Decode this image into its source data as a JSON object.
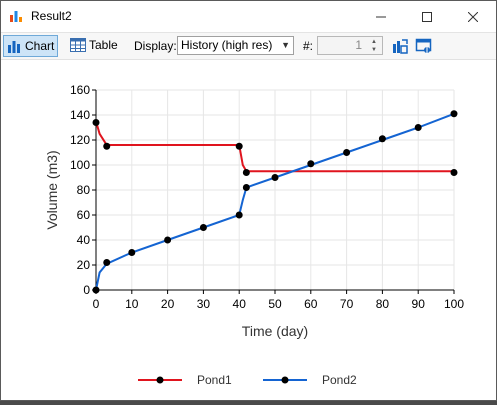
{
  "window": {
    "title": "Result2"
  },
  "toolbar": {
    "chart_label": "Chart",
    "table_label": "Table",
    "display_label": "Display:",
    "display_value": "History (high res)",
    "index_label": "#:",
    "index_value": "1"
  },
  "colors": {
    "pond1": "#e0141e",
    "pond2": "#1464d2",
    "accent": "#cde4f7"
  },
  "icons": {
    "app": "bar-chart-icon",
    "chart": "bar-chart-icon",
    "table": "table-grid-icon",
    "export": "export-icon",
    "settings": "settings-icon"
  },
  "chart_data": {
    "type": "line",
    "xlabel": "Time (day)",
    "ylabel": "Volume (m3)",
    "xlim": [
      0,
      100
    ],
    "ylim": [
      0,
      160
    ],
    "xticks": [
      0,
      10,
      20,
      30,
      40,
      50,
      60,
      70,
      80,
      90,
      100
    ],
    "yticks": [
      0,
      20,
      40,
      60,
      80,
      100,
      120,
      140,
      160
    ],
    "grid": true,
    "legend_position": "bottom",
    "series": [
      {
        "name": "Pond1",
        "color": "#e0141e",
        "points": [
          [
            0,
            135
          ],
          [
            1,
            125
          ],
          [
            3,
            116
          ],
          [
            40,
            116
          ],
          [
            41,
            100
          ],
          [
            42,
            95
          ],
          [
            100,
            95
          ]
        ],
        "markers": [
          [
            0,
            134
          ],
          [
            3,
            115
          ],
          [
            40,
            115
          ],
          [
            42,
            94
          ],
          [
            100,
            94
          ]
        ]
      },
      {
        "name": "Pond2",
        "color": "#1464d2",
        "points": [
          [
            0,
            0
          ],
          [
            1,
            14
          ],
          [
            3,
            21
          ],
          [
            10,
            30
          ],
          [
            20,
            40
          ],
          [
            30,
            50
          ],
          [
            40,
            60
          ],
          [
            41,
            72
          ],
          [
            42,
            82
          ],
          [
            50,
            90
          ],
          [
            60,
            100
          ],
          [
            70,
            110
          ],
          [
            80,
            120
          ],
          [
            90,
            130
          ],
          [
            100,
            141
          ]
        ],
        "markers": [
          [
            0,
            0
          ],
          [
            3,
            22
          ],
          [
            10,
            30
          ],
          [
            20,
            40
          ],
          [
            30,
            50
          ],
          [
            40,
            60
          ],
          [
            42,
            82
          ],
          [
            50,
            90
          ],
          [
            60,
            101
          ],
          [
            70,
            110
          ],
          [
            80,
            121
          ],
          [
            90,
            130
          ],
          [
            100,
            141
          ]
        ]
      }
    ]
  }
}
